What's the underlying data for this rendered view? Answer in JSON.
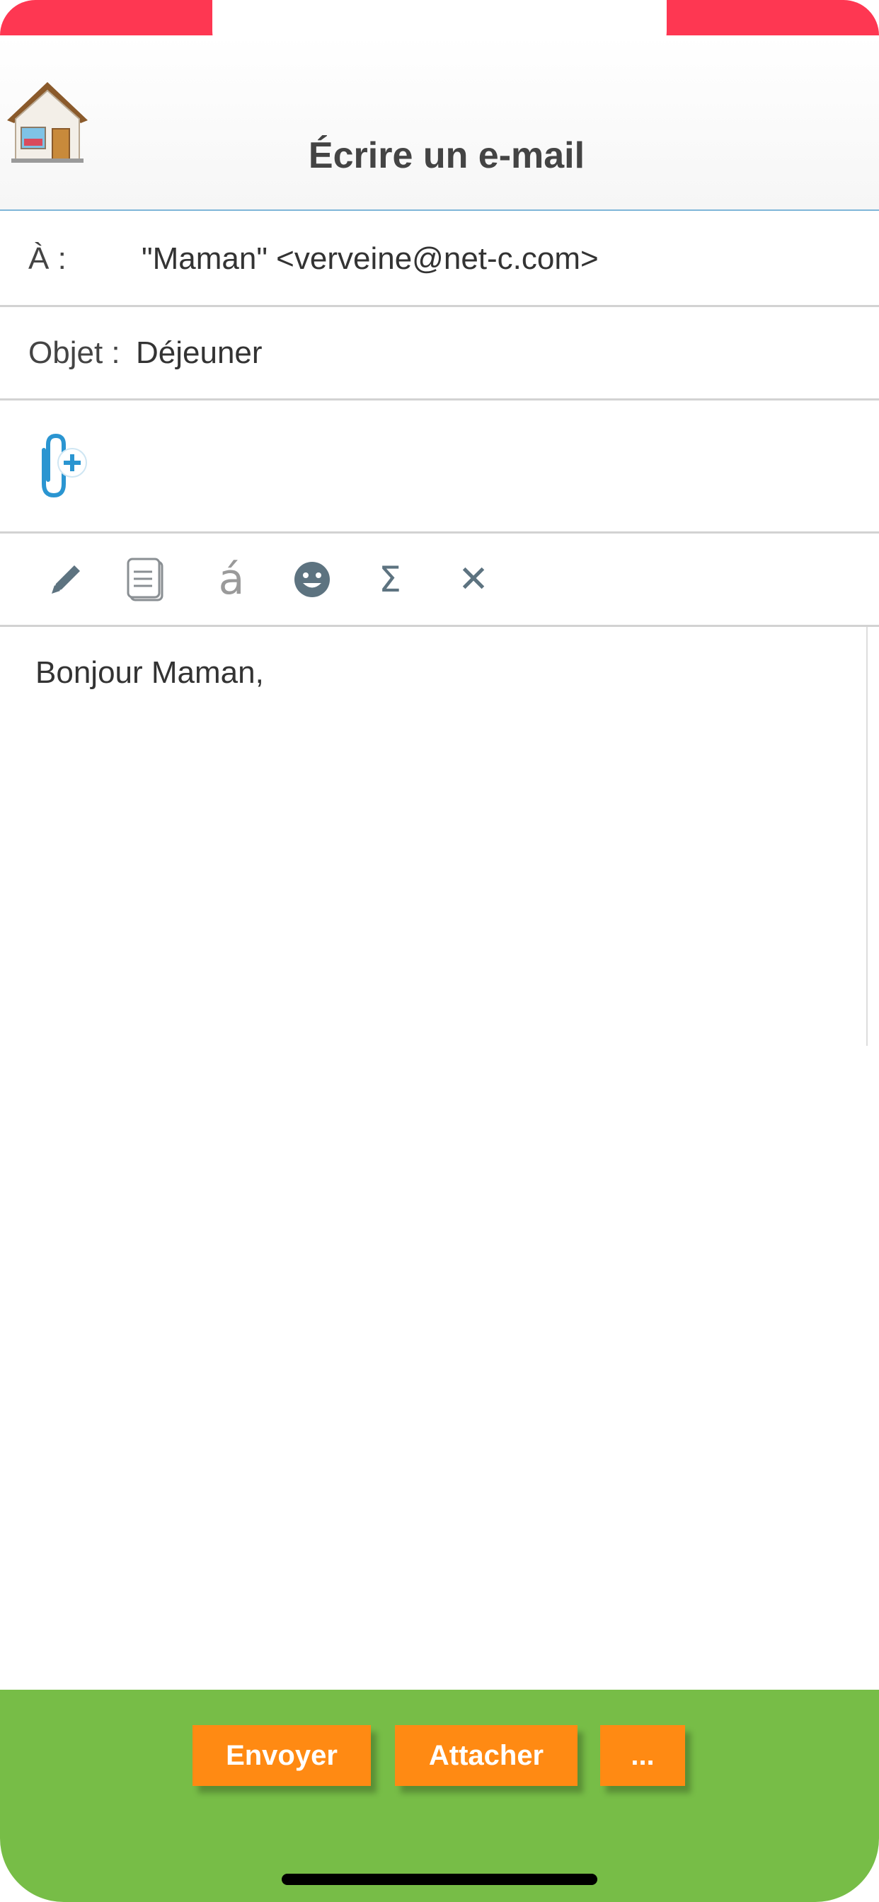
{
  "header": {
    "title": "Écrire un e-mail",
    "home_icon": "house-icon"
  },
  "form": {
    "to_label": "À :",
    "to_value": "\"Maman\" <verveine@net-c.com>",
    "subject_label": "Objet :",
    "subject_value": "Déjeuner",
    "attach_icon": "paperclip-add-icon"
  },
  "toolbar": {
    "tools": [
      "pencil-icon",
      "document-icon",
      "accent-icon",
      "smiley-icon",
      "sigma-icon",
      "close-icon"
    ],
    "accent_glyph": "á",
    "sigma_glyph": "Σ",
    "close_glyph": "✕"
  },
  "body": {
    "text": "Bonjour Maman,"
  },
  "bottom": {
    "send_label": "Envoyer",
    "attach_label": "Attacher",
    "more_label": "..."
  },
  "colors": {
    "status_red": "#fe3752",
    "bar_green": "#77bd47",
    "button_orange": "#ff8a13",
    "accent_blue": "#2a95d1"
  }
}
